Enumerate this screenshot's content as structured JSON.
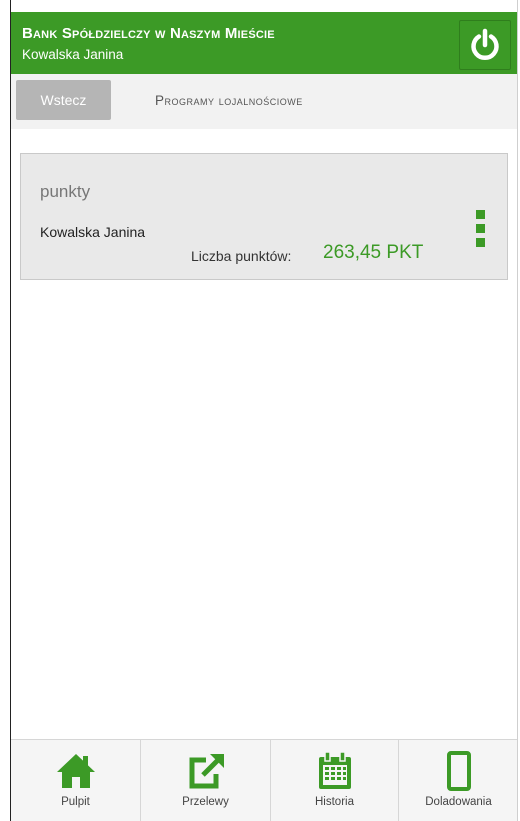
{
  "header": {
    "bank_name": "Bank Spółdzielczy w Naszym Mieście",
    "user_name": "Kowalska Janina",
    "logout_icon": "power-icon"
  },
  "toolbar": {
    "back_label": "Wstecz",
    "page_title": "Programy lojalnościowe"
  },
  "card": {
    "title": "punkty",
    "owner": "Kowalska Janina",
    "points_label": "Liczba punktów:",
    "points_value": "263,45 PKT",
    "menu_icon": "vertical-dots-menu-icon"
  },
  "bottom_nav": [
    {
      "label": "Pulpit",
      "icon": "home-icon"
    },
    {
      "label": "Przelewy",
      "icon": "transfer-icon"
    },
    {
      "label": "Historia",
      "icon": "calendar-icon"
    },
    {
      "label": "Doladowania",
      "icon": "phone-icon"
    }
  ],
  "colors": {
    "accent": "#3c9a26",
    "back_button": "#b5b5b5",
    "card_bg": "#e9e9e9"
  }
}
